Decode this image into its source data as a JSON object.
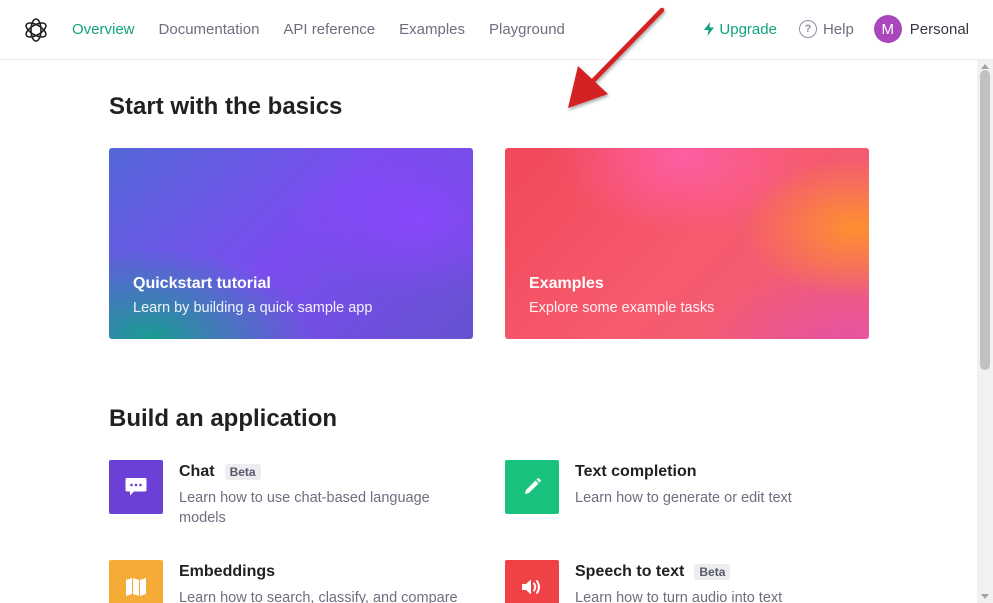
{
  "nav": {
    "links": [
      "Overview",
      "Documentation",
      "API reference",
      "Examples",
      "Playground"
    ],
    "active_index": 0,
    "upgrade_label": "Upgrade",
    "help_label": "Help",
    "help_glyph": "?",
    "avatar_initial": "M",
    "account_name": "Personal"
  },
  "basics": {
    "title": "Start with the basics",
    "cards": [
      {
        "title": "Quickstart tutorial",
        "subtitle": "Learn by building a quick sample app"
      },
      {
        "title": "Examples",
        "subtitle": "Explore some example tasks"
      }
    ]
  },
  "build": {
    "title": "Build an application",
    "items": [
      {
        "title": "Chat",
        "badge": "Beta",
        "description": "Learn how to use chat-based language models",
        "icon": "chat-bubble-icon",
        "color": "#6b40d6"
      },
      {
        "title": "Text completion",
        "badge": "",
        "description": "Learn how to generate or edit text",
        "icon": "pencil-icon",
        "color": "#19c37d"
      },
      {
        "title": "Embeddings",
        "badge": "",
        "description": "Learn how to search, classify, and compare",
        "icon": "book-icon",
        "color": "#f4ac36"
      },
      {
        "title": "Speech to text",
        "badge": "Beta",
        "description": "Learn how to turn audio into text",
        "icon": "speaker-icon",
        "color": "#ef4146"
      }
    ]
  },
  "colors": {
    "accent": "#10a37f",
    "avatar": "#ab47bc",
    "annotation_arrow": "#d42020"
  }
}
